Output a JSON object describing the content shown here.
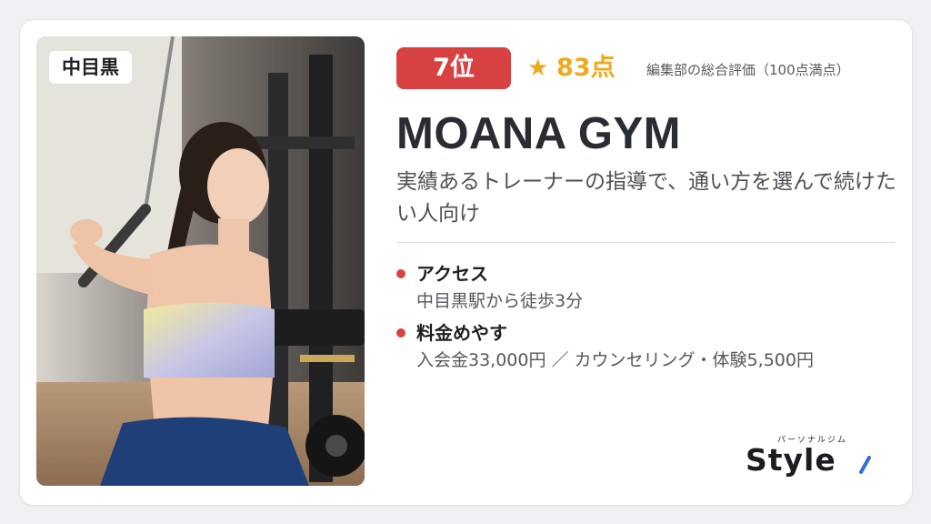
{
  "location_tag": "中目黒",
  "rank": {
    "label": "7位"
  },
  "rating": {
    "icon": "star-icon",
    "score": "83点",
    "note": "編集部の総合評価（100点満点）"
  },
  "gym": {
    "name": "MOANA GYM",
    "tagline": "実績あるトレーナーの指導で、通い方を選んで続けたい人向け"
  },
  "info": [
    {
      "title": "アクセス",
      "value": "中目黒駅から徒歩3分"
    },
    {
      "title": "料金めやす",
      "value": "入会金33,000円 ／ カウンセリング・体験5,500円"
    }
  ],
  "logo": {
    "sub": "パーソナルジム",
    "text": "Style"
  },
  "colors": {
    "accent": "#d84141",
    "star": "#f0a81c",
    "text": "#2a2c33"
  }
}
